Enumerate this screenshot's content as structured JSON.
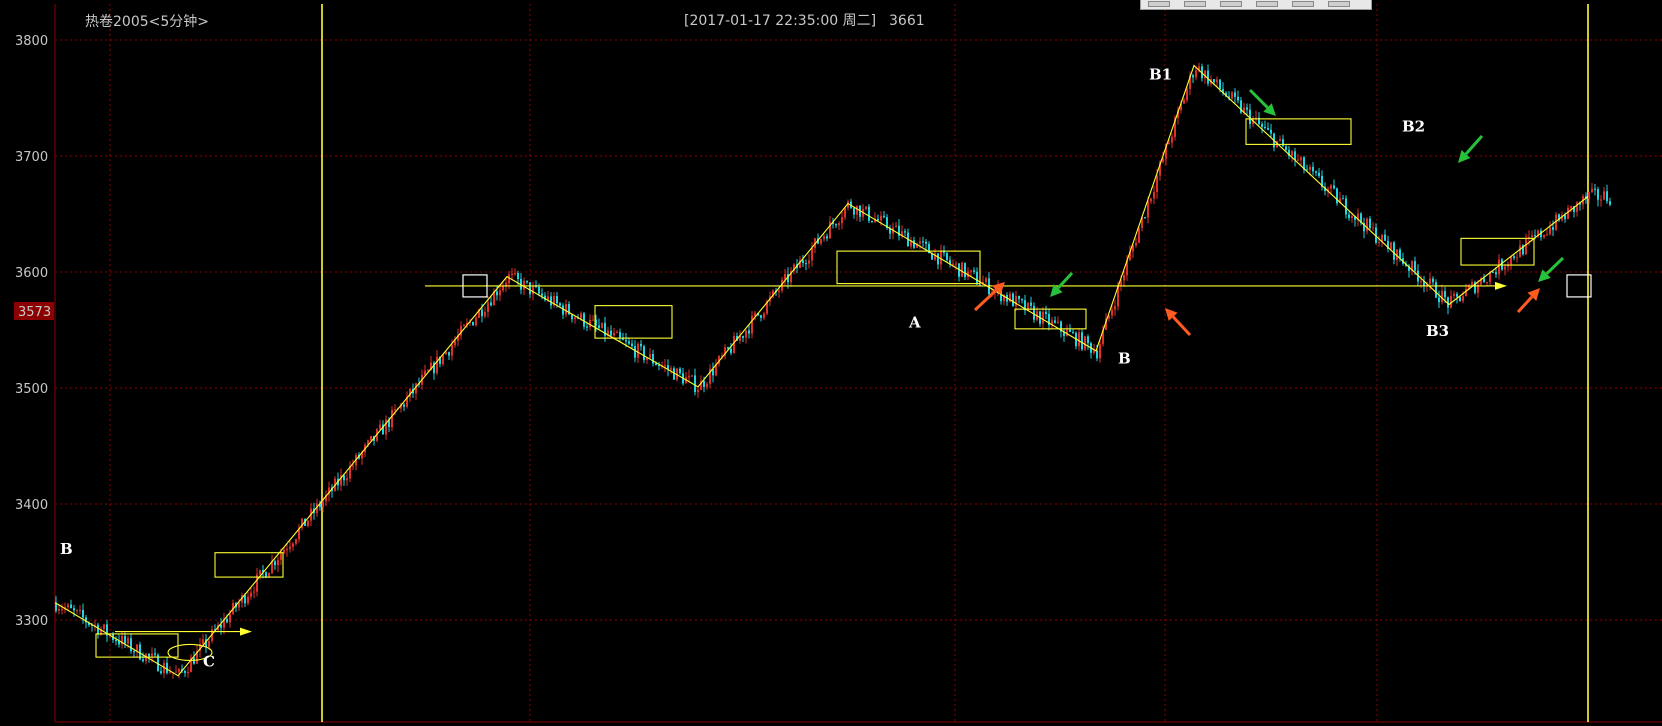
{
  "header": {
    "title": "热卷2005<5分钟>",
    "datetime": "[2017-01-17  22:35:00 周二]",
    "price": "3661"
  },
  "toolbar": {
    "button_count": 6
  },
  "colors": {
    "background": "#000000",
    "up": "#e0302a",
    "down": "#1fd6e0",
    "grid": "#8b0000",
    "annotation": "#ffff33",
    "price_badge": "#8b0000"
  },
  "chart_data": {
    "type": "candlestick",
    "ylim": [
      3230,
      3830
    ],
    "yticks": [
      3300,
      3400,
      3500,
      3600,
      3700,
      3800
    ],
    "current_price_label": "3573",
    "zigzag": [
      [
        0,
        3315
      ],
      [
        123,
        3252
      ],
      [
        452,
        3596
      ],
      [
        643,
        3501
      ],
      [
        793,
        3659
      ],
      [
        1041,
        3532
      ],
      [
        1139,
        3778
      ],
      [
        1394,
        3572
      ],
      [
        1533,
        3665
      ]
    ],
    "level_line": {
      "value": 3588,
      "from": 370,
      "to": 1440
    },
    "boxes": [
      {
        "from": 41,
        "to": 123,
        "lo": 3268,
        "hi": 3288
      },
      {
        "from": 160,
        "to": 228,
        "lo": 3337,
        "hi": 3358
      },
      {
        "from": 540,
        "to": 617,
        "lo": 3543,
        "hi": 3571
      },
      {
        "from": 782,
        "to": 925,
        "lo": 3590,
        "hi": 3618
      },
      {
        "from": 960,
        "to": 1031,
        "lo": 3551,
        "hi": 3568
      },
      {
        "from": 1191,
        "to": 1296,
        "lo": 3710,
        "hi": 3732
      },
      {
        "from": 1406,
        "to": 1479,
        "lo": 3606,
        "hi": 3629
      }
    ],
    "labels": [
      {
        "text": "B",
        "x": 5,
        "y": 3357
      },
      {
        "text": "C",
        "x": 148,
        "y": 3260
      },
      {
        "text": "A",
        "x": 854,
        "y": 3552
      },
      {
        "text": "B",
        "x": 1063,
        "y": 3521
      },
      {
        "text": "B1",
        "x": 1094,
        "y": 3766
      },
      {
        "text": "B2",
        "x": 1347,
        "y": 3721
      },
      {
        "text": "B3",
        "x": 1371,
        "y": 3545
      }
    ]
  }
}
